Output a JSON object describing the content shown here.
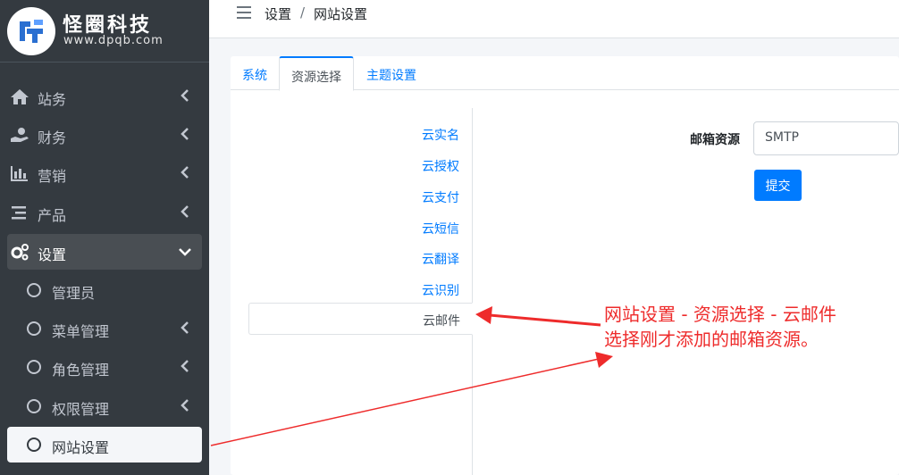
{
  "brand": {
    "name": "怪圈科技",
    "url": "www.dpqb.com"
  },
  "sidebar": {
    "items": [
      {
        "label": "站务",
        "icon": "home-icon"
      },
      {
        "label": "财务",
        "icon": "hand-money-icon"
      },
      {
        "label": "营销",
        "icon": "bar-chart-icon"
      },
      {
        "label": "产品",
        "icon": "list-icon"
      },
      {
        "label": "设置",
        "icon": "cogs-icon"
      }
    ],
    "sub_items": [
      {
        "label": "管理员"
      },
      {
        "label": "菜单管理"
      },
      {
        "label": "角色管理"
      },
      {
        "label": "权限管理"
      },
      {
        "label": "网站设置"
      }
    ]
  },
  "breadcrumb": {
    "parent": "设置",
    "separator": "/",
    "current": "网站设置"
  },
  "tabs": [
    {
      "label": "系统"
    },
    {
      "label": "资源选择"
    },
    {
      "label": "主题设置"
    }
  ],
  "resource_menu": [
    {
      "label": "云实名"
    },
    {
      "label": "云授权"
    },
    {
      "label": "云支付"
    },
    {
      "label": "云短信"
    },
    {
      "label": "云翻译"
    },
    {
      "label": "云识别"
    },
    {
      "label": "云邮件"
    }
  ],
  "form": {
    "mailbox_label": "邮箱资源",
    "mailbox_value": "SMTP",
    "submit_label": "提交"
  },
  "annotation": {
    "line1": "网站设置 - 资源选择 - 云邮件",
    "line2": "选择刚才添加的邮箱资源。",
    "color": "#ee2b2b"
  },
  "colors": {
    "sidebar": "#343a40",
    "accent": "#007bff"
  }
}
